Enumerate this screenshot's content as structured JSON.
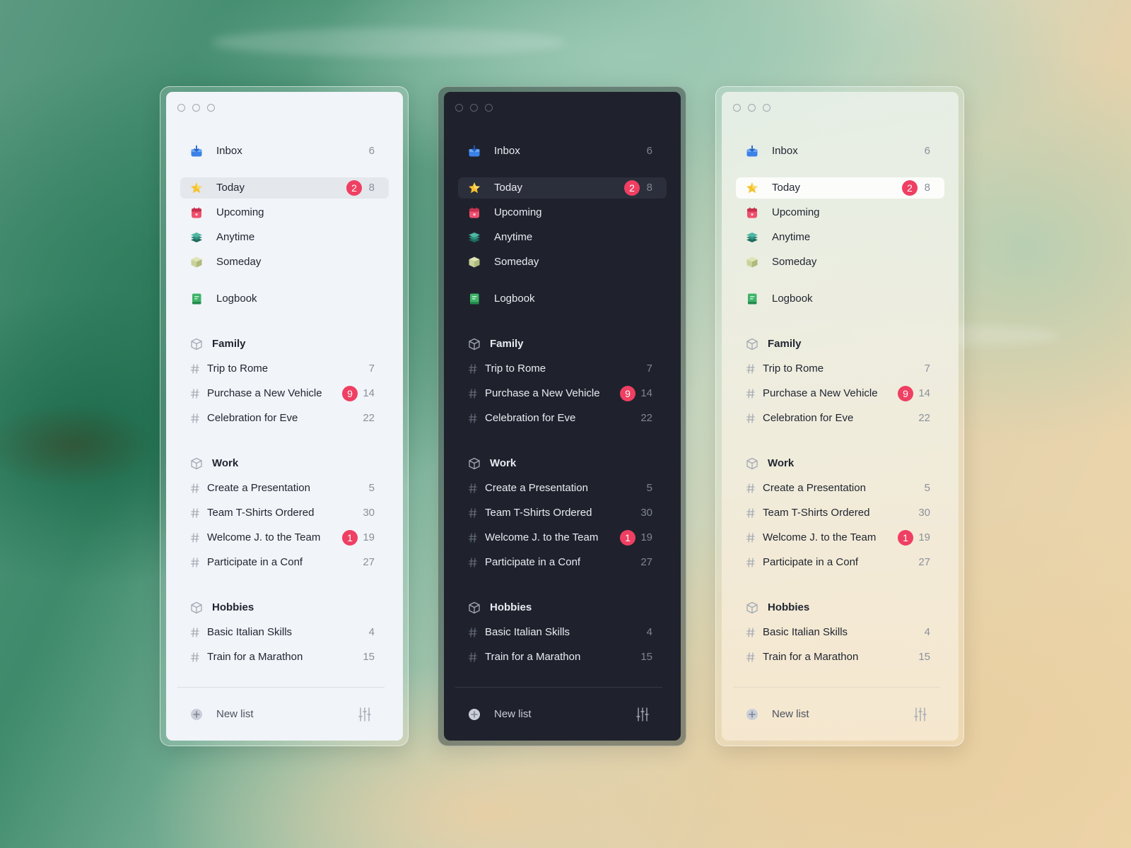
{
  "windows": [
    {
      "theme": "light",
      "inbox": {
        "label": "Inbox",
        "count": "6"
      },
      "today": {
        "label": "Today",
        "badge": "2",
        "count": "8"
      },
      "upcoming": {
        "label": "Upcoming"
      },
      "anytime": {
        "label": "Anytime"
      },
      "someday": {
        "label": "Someday"
      },
      "logbook": {
        "label": "Logbook"
      },
      "groups": [
        {
          "name": "Family",
          "projects": [
            {
              "name": "Trip to Rome",
              "badge": "",
              "count": "7"
            },
            {
              "name": "Purchase a New Vehicle",
              "badge": "9",
              "count": "14"
            },
            {
              "name": "Celebration for Eve",
              "badge": "",
              "count": "22"
            }
          ]
        },
        {
          "name": "Work",
          "projects": [
            {
              "name": "Create a Presentation",
              "badge": "",
              "count": "5"
            },
            {
              "name": "Team T-Shirts Ordered",
              "badge": "",
              "count": "30"
            },
            {
              "name": "Welcome J. to the Team",
              "badge": "1",
              "count": "19"
            },
            {
              "name": "Participate in a Conf",
              "badge": "",
              "count": "27"
            }
          ]
        },
        {
          "name": "Hobbies",
          "projects": [
            {
              "name": "Basic Italian Skills",
              "badge": "",
              "count": "4"
            },
            {
              "name": "Train for a Marathon",
              "badge": "",
              "count": "15"
            }
          ]
        }
      ],
      "new_list": "New list"
    },
    {
      "theme": "dark",
      "inbox": {
        "label": "Inbox",
        "count": "6"
      },
      "today": {
        "label": "Today",
        "badge": "2",
        "count": "8"
      },
      "upcoming": {
        "label": "Upcoming"
      },
      "anytime": {
        "label": "Anytime"
      },
      "someday": {
        "label": "Someday"
      },
      "logbook": {
        "label": "Logbook"
      },
      "groups": [
        {
          "name": "Family",
          "projects": [
            {
              "name": "Trip to Rome",
              "badge": "",
              "count": "7"
            },
            {
              "name": "Purchase a New Vehicle",
              "badge": "9",
              "count": "14"
            },
            {
              "name": "Celebration for Eve",
              "badge": "",
              "count": "22"
            }
          ]
        },
        {
          "name": "Work",
          "projects": [
            {
              "name": "Create a Presentation",
              "badge": "",
              "count": "5"
            },
            {
              "name": "Team T-Shirts Ordered",
              "badge": "",
              "count": "30"
            },
            {
              "name": "Welcome J. to the Team",
              "badge": "1",
              "count": "19"
            },
            {
              "name": "Participate in a Conf",
              "badge": "",
              "count": "27"
            }
          ]
        },
        {
          "name": "Hobbies",
          "projects": [
            {
              "name": "Basic Italian Skills",
              "badge": "",
              "count": "4"
            },
            {
              "name": "Train for a Marathon",
              "badge": "",
              "count": "15"
            }
          ]
        }
      ],
      "new_list": "New list"
    },
    {
      "theme": "warm",
      "inbox": {
        "label": "Inbox",
        "count": "6"
      },
      "today": {
        "label": "Today",
        "badge": "2",
        "count": "8"
      },
      "upcoming": {
        "label": "Upcoming"
      },
      "anytime": {
        "label": "Anytime"
      },
      "someday": {
        "label": "Someday"
      },
      "logbook": {
        "label": "Logbook"
      },
      "groups": [
        {
          "name": "Family",
          "projects": [
            {
              "name": "Trip to Rome",
              "badge": "",
              "count": "7"
            },
            {
              "name": "Purchase a New Vehicle",
              "badge": "9",
              "count": "14"
            },
            {
              "name": "Celebration for Eve",
              "badge": "",
              "count": "22"
            }
          ]
        },
        {
          "name": "Work",
          "projects": [
            {
              "name": "Create a Presentation",
              "badge": "",
              "count": "5"
            },
            {
              "name": "Team T-Shirts Ordered",
              "badge": "",
              "count": "30"
            },
            {
              "name": "Welcome J. to the Team",
              "badge": "1",
              "count": "19"
            },
            {
              "name": "Participate in a Conf",
              "badge": "",
              "count": "27"
            }
          ]
        },
        {
          "name": "Hobbies",
          "projects": [
            {
              "name": "Basic Italian Skills",
              "badge": "",
              "count": "4"
            },
            {
              "name": "Train for a Marathon",
              "badge": "",
              "count": "15"
            }
          ]
        }
      ],
      "new_list": "New list"
    }
  ],
  "colors": {
    "badge": "#ef3f62",
    "inbox_icon": "#3b82e8",
    "today_icon": "#f6c22f",
    "upcoming_icon": "#f0506e",
    "anytime_icon": "#2f8f7e",
    "someday_icon": "#c9d29a",
    "logbook_icon": "#3fb36a"
  },
  "icons": [
    "inbox-icon",
    "star-icon",
    "calendar-icon",
    "layers-icon",
    "box-icon",
    "book-icon",
    "cube-icon",
    "hash-icon",
    "plus-circle-icon",
    "sliders-icon"
  ]
}
